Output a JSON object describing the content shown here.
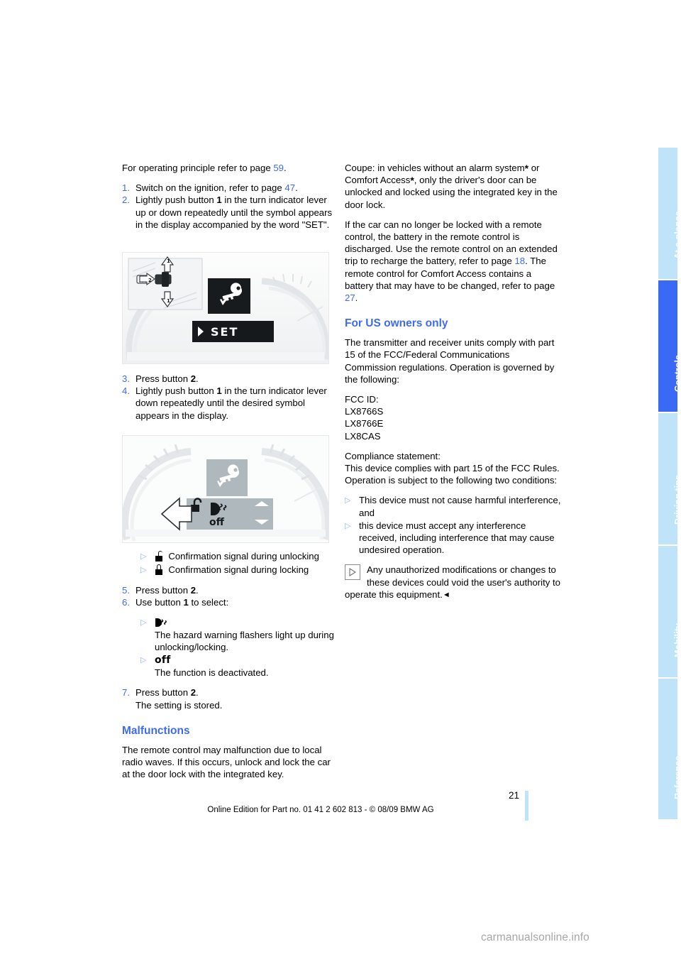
{
  "document": {
    "page_number": "21",
    "footer_text": "Online Edition for Part no. 01 41 2 602 813 - © 08/09 BMW AG",
    "watermark": "carmanualsonline.info"
  },
  "tabs": [
    {
      "label": "At a glance",
      "active": false
    },
    {
      "label": "Controls",
      "active": true
    },
    {
      "label": "Driving tips",
      "active": false
    },
    {
      "label": "Mobility",
      "active": false
    },
    {
      "label": "Reference",
      "active": false
    }
  ],
  "colors": {
    "accent_blue": "#3f6bf0",
    "tab_active": "#3a69f5",
    "tab_inactive": "#bfe4fa",
    "bullet_blue": "#8fb4f7"
  },
  "left_column": {
    "intro_prefix": "For operating principle refer to page ",
    "intro_pageref": "59",
    "intro_suffix": ".",
    "steps_1": [
      {
        "num": "1.",
        "parts": [
          {
            "t": "Switch on the ignition, refer to page "
          },
          {
            "t": "47",
            "style": "pageref"
          },
          {
            "t": "."
          }
        ]
      },
      {
        "num": "2.",
        "parts": [
          {
            "t": "Lightly push button "
          },
          {
            "t": "1",
            "style": "bold"
          },
          {
            "t": " in the turn indicator lever up or down repeatedly until the symbol appears in the display accompanied by the word \"SET\"."
          }
        ]
      }
    ],
    "steps_2": [
      {
        "num": "3.",
        "parts": [
          {
            "t": "Press button "
          },
          {
            "t": "2",
            "style": "bold"
          },
          {
            "t": "."
          }
        ]
      },
      {
        "num": "4.",
        "parts": [
          {
            "t": "Lightly push button "
          },
          {
            "t": "1",
            "style": "bold"
          },
          {
            "t": " in the turn indicator lever down repeatedly until the desired symbol appears in the display."
          }
        ]
      }
    ],
    "signal_bullets": [
      {
        "icon": "padlock-open-icon",
        "text": "Confirmation signal during unlocking"
      },
      {
        "icon": "padlock-closed-icon",
        "text": "Confirmation signal during locking"
      }
    ],
    "steps_3": [
      {
        "num": "5.",
        "parts": [
          {
            "t": "Press button "
          },
          {
            "t": "2",
            "style": "bold"
          },
          {
            "t": "."
          }
        ]
      },
      {
        "num": "6.",
        "parts": [
          {
            "t": "Use button "
          },
          {
            "t": "1",
            "style": "bold"
          },
          {
            "t": " to select:"
          }
        ]
      }
    ],
    "select_options": [
      {
        "icon": "hazard-flasher-icon",
        "label": "",
        "desc": "The hazard warning flashers light up during unlocking/locking."
      },
      {
        "icon": "off-text",
        "label": "off",
        "desc": "The function is deactivated."
      }
    ],
    "steps_4": [
      {
        "num": "7.",
        "parts": [
          {
            "t": "Press button "
          },
          {
            "t": "2",
            "style": "bold"
          },
          {
            "t": "."
          }
        ],
        "sub": "The setting is stored."
      }
    ],
    "malfunctions_heading": "Malfunctions",
    "malfunctions_body": "The remote control may malfunction due to local radio waves. If this occurs, unlock and lock the car at the door lock with the integrated key."
  },
  "right_column": {
    "para_coupe": [
      {
        "t": "Coupe: in vehicles without an alarm system"
      },
      {
        "t": "*",
        "style": "ast"
      },
      {
        "t": " or Comfort Access"
      },
      {
        "t": "*",
        "style": "ast"
      },
      {
        "t": ", only the driver's door can be unlocked and locked using the integrated key in the door lock."
      }
    ],
    "para_battery": [
      {
        "t": "If the car can no longer be locked with a remote control, the battery in the remote control is discharged. Use the remote control on an extended trip to recharge the battery, refer to page "
      },
      {
        "t": "18",
        "style": "pageref"
      },
      {
        "t": ". The remote control for Comfort Access contains a battery that may have to be changed, refer to page "
      },
      {
        "t": "27",
        "style": "pageref"
      },
      {
        "t": "."
      }
    ],
    "us_heading": "For US owners only",
    "us_intro": "The transmitter and receiver units comply with part 15 of the FCC/Federal Communications Commission regulations. Operation is governed by the following:",
    "fcc_id_label": "FCC ID:",
    "fcc_ids": [
      "LX8766S",
      "LX8766E",
      "LX8CAS"
    ],
    "compliance_label": "Compliance statement:",
    "compliance_body": "This device complies with part 15 of the FCC Rules. Operation is subject to the following two conditions:",
    "conditions": [
      "This device must not cause harmful interference, and",
      "this device must accept any interference received, including interference that may cause undesired operation."
    ],
    "note_text": "Any unauthorized modifications or changes to these devices could void the user's authority to operate this equipment.",
    "note_endmark": "◄"
  },
  "figures": {
    "figure_1": {
      "name": "turn-indicator-lever-and-display-set",
      "display_word": "SET",
      "callout_1": "1",
      "callout_2": "2",
      "callout_1b": "1"
    },
    "figure_2": {
      "name": "instrument-cluster-unlock-confirmation-setting",
      "off_word": "off"
    }
  }
}
